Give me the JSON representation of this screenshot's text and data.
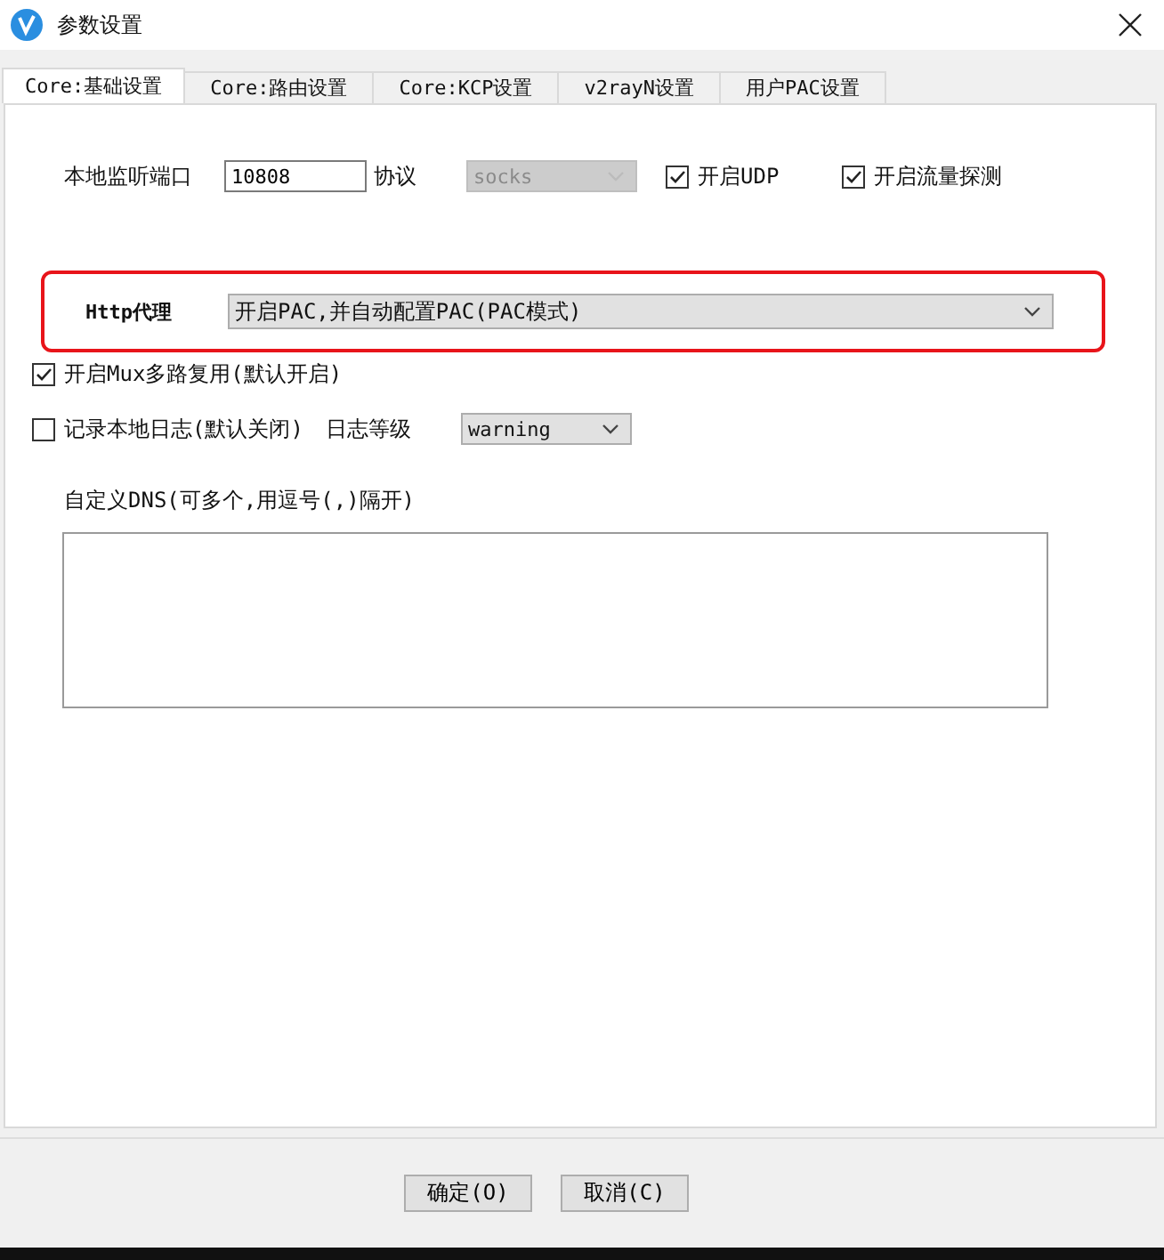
{
  "window": {
    "title": "参数设置"
  },
  "tabs": [
    {
      "label": "Core:基础设置",
      "selected": true
    },
    {
      "label": "Core:路由设置",
      "selected": false
    },
    {
      "label": "Core:KCP设置",
      "selected": false
    },
    {
      "label": "v2rayN设置",
      "selected": false
    },
    {
      "label": "用户PAC设置",
      "selected": false
    }
  ],
  "local_port": {
    "label": "本地监听端口",
    "value": "10808"
  },
  "protocol": {
    "label": "协议",
    "value": "socks",
    "disabled": true
  },
  "udp": {
    "label": "开启UDP",
    "checked": true
  },
  "sniffing": {
    "label": "开启流量探测",
    "checked": true
  },
  "http_proxy": {
    "label": "Http代理",
    "value": "开启PAC,并自动配置PAC(PAC模式)",
    "highlighted": true
  },
  "mux": {
    "label": "开启Mux多路复用(默认开启)",
    "checked": true
  },
  "log": {
    "label": "记录本地日志(默认关闭)",
    "checked": false
  },
  "log_level": {
    "label": "日志等级",
    "value": "warning",
    "disabled": false
  },
  "dns": {
    "label": "自定义DNS(可多个,用逗号(,)隔开)"
  },
  "buttons": [
    "确定(O)",
    "取消(C)"
  ]
}
